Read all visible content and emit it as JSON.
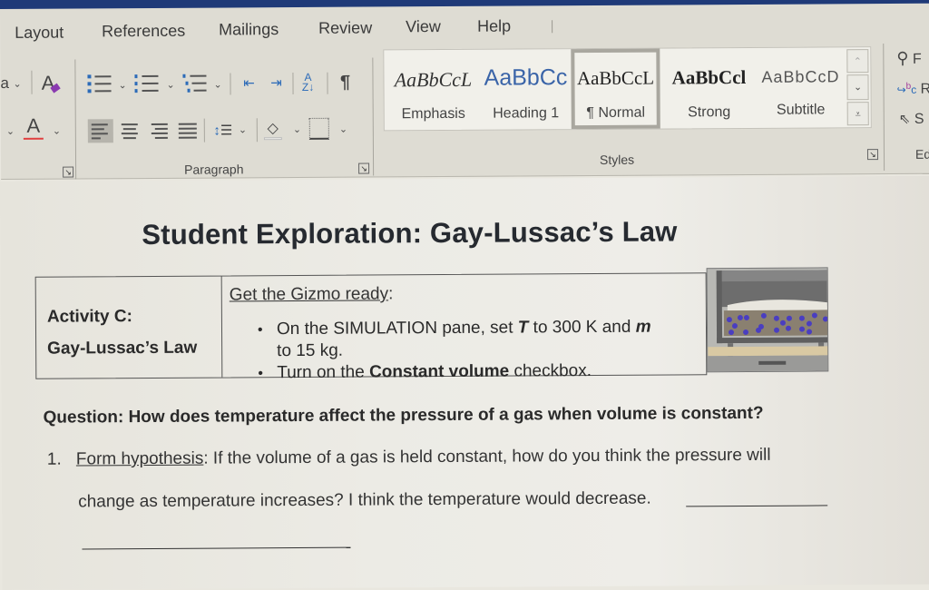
{
  "ribbon": {
    "tabs": [
      "Layout",
      "References",
      "Mailings",
      "Review",
      "View",
      "Help"
    ],
    "font_group": {
      "font_partial_label": "a",
      "clear_formatting_icon": "clear-formatting-icon",
      "font_color_icon": "font-color-icon",
      "font_color_swatch": "#e04040"
    },
    "paragraph_group": {
      "label": "Paragraph",
      "buttons": [
        "Bullets",
        "Numbering",
        "Multilevel List",
        "Decrease Indent",
        "Increase Indent",
        "Sort",
        "Show/Hide ¶",
        "Align Left",
        "Center",
        "Align Right",
        "Justify",
        "Line and Paragraph Spacing",
        "Shading",
        "Borders"
      ],
      "selected_alignment": "Align Left",
      "sort_glyph": "A Z ↓",
      "pilcrow": "¶"
    },
    "styles_group": {
      "label": "Styles",
      "items": [
        {
          "sample": "AaBbCcL",
          "name": "Emphasis"
        },
        {
          "sample": "AaBbCc",
          "name": "Heading 1"
        },
        {
          "sample": "AaBbCcL",
          "name": "¶ Normal",
          "selected": true
        },
        {
          "sample": "AaBbCcl",
          "name": "Strong"
        },
        {
          "sample": "AaBbCcD",
          "name": "Subtitle"
        }
      ],
      "heading_color": "#3a64a8"
    },
    "editing_group": {
      "label_partial": "Ed",
      "items": [
        {
          "icon": "search-icon",
          "label_partial": "F"
        },
        {
          "icon": "replace-icon",
          "label_partial": "R"
        },
        {
          "icon": "select-cursor-icon",
          "label_partial": "S"
        }
      ]
    }
  },
  "document": {
    "title": "Student Exploration: Gay-Lussac’s Law",
    "activity": {
      "line1": "Activity C:",
      "line2": "Gay-Lussac’s Law"
    },
    "gizmo": {
      "heading": "Get the Gizmo ready",
      "heading_suffix": ":",
      "bullet1_a": "On the SIMULATION pane, set ",
      "bullet1_T": "T",
      "bullet1_b": " to 300 K and ",
      "bullet1_m": "m",
      "bullet1_cont": "to 15 kg.",
      "bullet2_a": "Turn on the ",
      "bullet2_bold": "Constant volume",
      "bullet2_b": " checkbox.",
      "bullet_glyph": "•"
    },
    "question": "Question: How does temperature affect the pressure of a gas when volume is constant?",
    "item1": {
      "number": "1.",
      "label": "Form hypothesis",
      "text_line1": ": If the volume of a gas is held constant, how do you think the pressure will",
      "text_line2": "change as temperature increases? I think the temperature would decrease."
    }
  }
}
